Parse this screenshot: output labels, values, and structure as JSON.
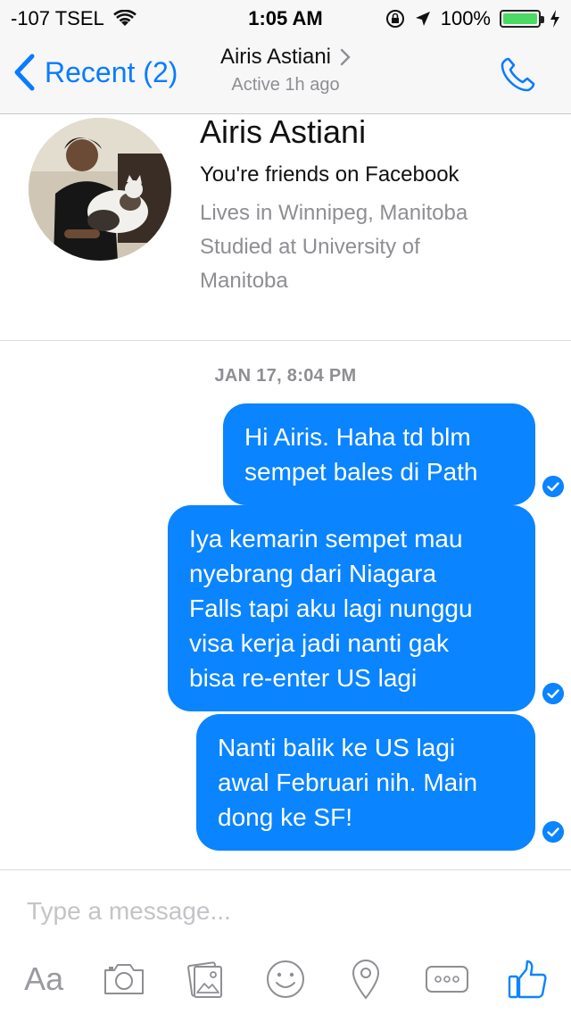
{
  "status": {
    "carrier": "-107 TSEL",
    "time": "1:05 AM",
    "battery": "100%"
  },
  "nav": {
    "back_label": "Recent (2)",
    "title": "Airis Astiani",
    "subtitle": "Active 1h ago"
  },
  "profile": {
    "name": "Airis Astiani",
    "friend_status": "You're friends on Facebook",
    "lines": [
      "Lives in Winnipeg, Manitoba",
      "Studied at University of",
      "Manitoba"
    ]
  },
  "conversation": {
    "timestamp": "JAN 17, 8:04 PM",
    "messages": [
      {
        "lines": [
          "Hi Airis. Haha td blm",
          "sempet bales di Path"
        ],
        "status": "seen"
      },
      {
        "lines": [
          "Iya kemarin sempet mau",
          "nyebrang dari Niagara",
          "Falls tapi aku lagi nunggu",
          "visa kerja jadi nanti gak",
          "bisa re-enter US lagi"
        ],
        "status": "seen"
      },
      {
        "lines": [
          "Nanti balik ke US lagi",
          "awal Februari nih. Main",
          "dong ke SF!"
        ],
        "status": "seen"
      }
    ]
  },
  "composer": {
    "placeholder": "Type a message...",
    "tools": {
      "text": "Aa"
    }
  },
  "colors": {
    "accent": "#0a84ff",
    "bubble": "#0a84ff",
    "bar": "#f7f7f8",
    "muted": "#8e8e93",
    "battery": "#4cd964"
  }
}
